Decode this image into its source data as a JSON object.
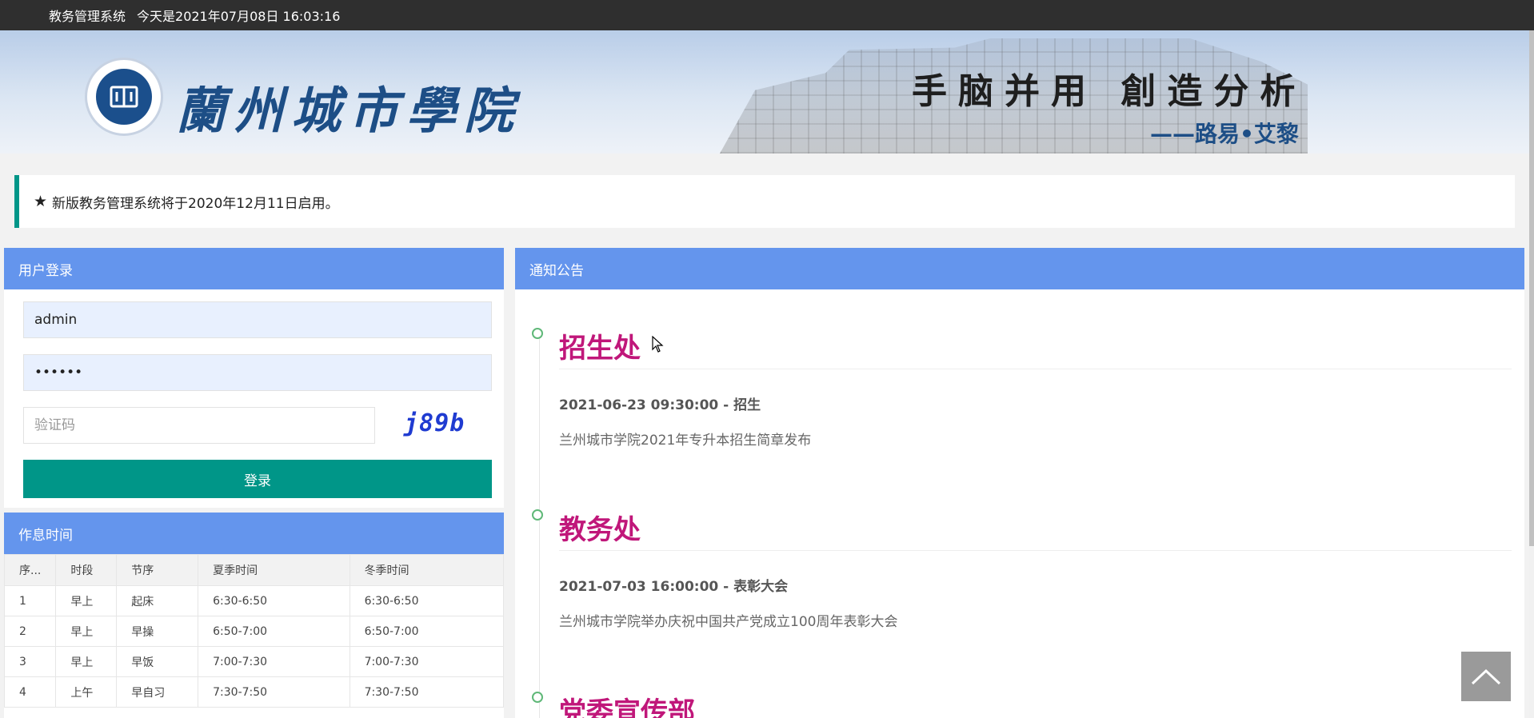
{
  "topbar": {
    "system_name": "教务管理系统",
    "datetime": "今天是2021年07月08日 16:03:16"
  },
  "banner": {
    "school_name": "蘭州城市學院",
    "motto": "手脑并用 創造分析",
    "motto_author": "——路易•艾黎"
  },
  "notice": {
    "icon": "star-icon",
    "text": "新版教务管理系统将于2020年12月11日启用。"
  },
  "login": {
    "title": "用户登录",
    "username_value": "admin",
    "password_value": "••••••",
    "captcha_placeholder": "验证码",
    "captcha_text": "j89b",
    "submit_label": "登录"
  },
  "schedule": {
    "title": "作息时间",
    "headers": [
      "序...",
      "时段",
      "节序",
      "夏季时间",
      "冬季时间"
    ],
    "rows": [
      [
        "1",
        "早上",
        "起床",
        "6:30-6:50",
        "6:30-6:50"
      ],
      [
        "2",
        "早上",
        "早操",
        "6:50-7:00",
        "6:50-7:00"
      ],
      [
        "3",
        "早上",
        "早饭",
        "7:00-7:30",
        "7:00-7:30"
      ],
      [
        "4",
        "上午",
        "早自习",
        "7:30-7:50",
        "7:30-7:50"
      ]
    ]
  },
  "announcements": {
    "title": "通知公告",
    "items": [
      {
        "department": "招生处",
        "meta": "2021-06-23 09:30:00 - 招生",
        "description": "兰州城市学院2021年专升本招生简章发布"
      },
      {
        "department": "教务处",
        "meta": "2021-07-03 16:00:00 - 表彰大会",
        "description": "兰州城市学院举办庆祝中国共产党成立100周年表彰大会"
      },
      {
        "department": "党委宣传部",
        "meta": "",
        "description": ""
      }
    ]
  },
  "colors": {
    "topbar_bg": "#2f2f2f",
    "panel_header": "#6495ed",
    "primary_button": "#009688",
    "announcement_title": "#c0177a",
    "timeline_dot": "#5fb878"
  }
}
